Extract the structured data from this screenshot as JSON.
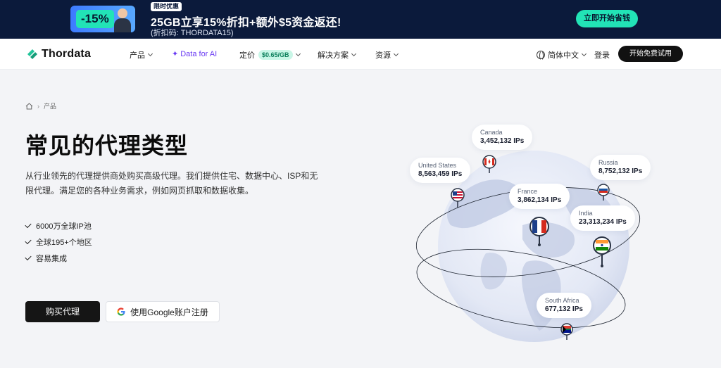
{
  "promo": {
    "discount": "-15%",
    "tag": "限时优惠",
    "title": "25GB立享15%折扣+额外$5资金返还!",
    "code": "(折扣码: THORDATA15)",
    "cta": "立即开始省钱",
    "colors": {
      "background": "#0b1a3b",
      "accent": "#22e3b6"
    }
  },
  "nav": {
    "brand": "Thordata",
    "items": [
      {
        "label": "产品",
        "has_dropdown": true
      },
      {
        "label": "Data for AI",
        "has_dropdown": false
      },
      {
        "label": "定价",
        "badge": "$0.65/GB",
        "has_dropdown": true
      },
      {
        "label": "解决方案",
        "has_dropdown": true
      },
      {
        "label": "资源",
        "has_dropdown": true
      }
    ],
    "language": "简体中文",
    "login": "登录",
    "trial": "开始免费试用"
  },
  "breadcrumb": {
    "current": "产品"
  },
  "hero": {
    "title": "常见的代理类型",
    "description": "从行业领先的代理提供商处购买高级代理。我们提供住宅、数据中心、ISP和无限代理。满足您的各种业务需求，例如网页抓取和数据收集。",
    "features": [
      "6000万全球IP池",
      "全球195+个地区",
      "容易集成"
    ],
    "buy_button": "购买代理",
    "google_button": "使用Google账户注册"
  },
  "map": {
    "locations": [
      {
        "country": "Canada",
        "ips": "3,452,132 IPs"
      },
      {
        "country": "United States",
        "ips": "8,563,459 IPs"
      },
      {
        "country": "Russia",
        "ips": "8,752,132 IPs"
      },
      {
        "country": "France",
        "ips": "3,862,134 IPs"
      },
      {
        "country": "India",
        "ips": "23,313,234 IPs"
      },
      {
        "country": "South Africa",
        "ips": "677,132 IPs"
      }
    ]
  },
  "icons": [
    "thordata-logo-icon",
    "sparkle-icon",
    "globe-icon",
    "home-icon",
    "chevron-right-icon",
    "check-icon",
    "google-icon",
    "flag-pin-icon"
  ]
}
